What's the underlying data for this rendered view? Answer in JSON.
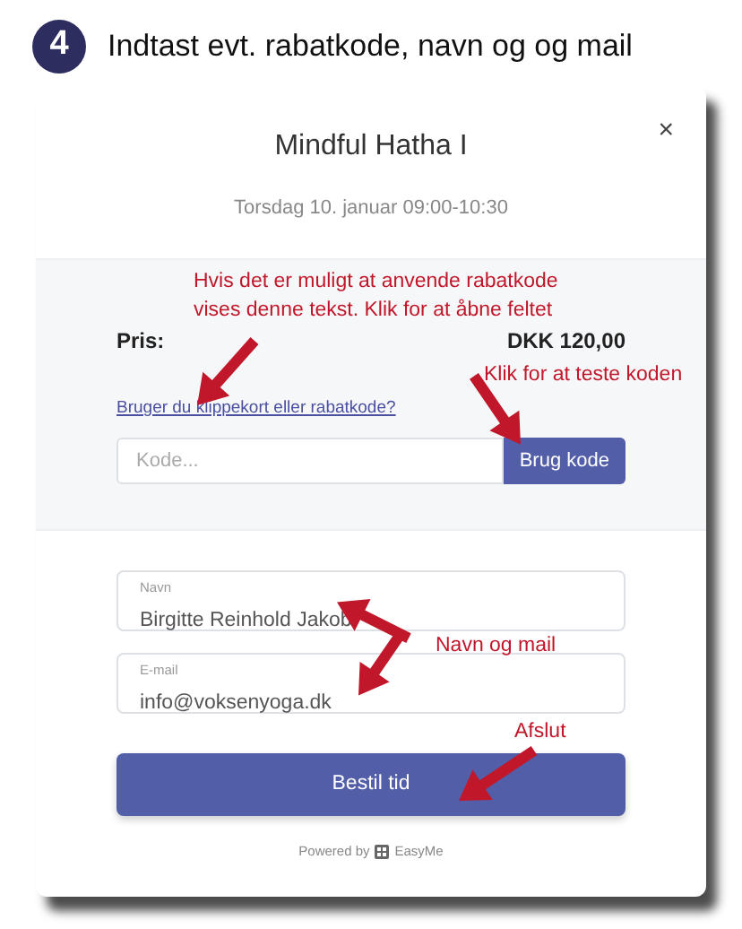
{
  "step": {
    "number": "4",
    "title": "Indtast evt. rabatkode, navn og og mail"
  },
  "modal": {
    "close": "×",
    "title": "Mindful Hatha I",
    "subtitle": "Torsdag 10. januar 09:00-10:30"
  },
  "price": {
    "label": "Pris:",
    "value": "DKK 120,00"
  },
  "discount": {
    "link": "Bruger du klippekort eller rabatkode?",
    "placeholder": "Kode...",
    "button": "Brug kode"
  },
  "fields": [
    {
      "label": "Navn",
      "value": "Birgitte Reinhold Jakob"
    },
    {
      "label": "E-mail",
      "value": "info@voksenyoga.dk"
    }
  ],
  "submit": "Bestil tid",
  "footer": {
    "powered_by": "Powered by",
    "brand": "EasyMe"
  },
  "annotations": [
    {
      "lines": [
        "Hvis det er muligt at anvende rabatkode",
        "vises denne tekst. Klik for at åbne feltet"
      ]
    },
    {
      "lines": [
        "Klik for at teste koden"
      ]
    },
    {
      "lines": [
        "Navn og mail"
      ]
    },
    {
      "lines": [
        "Afslut"
      ]
    }
  ]
}
